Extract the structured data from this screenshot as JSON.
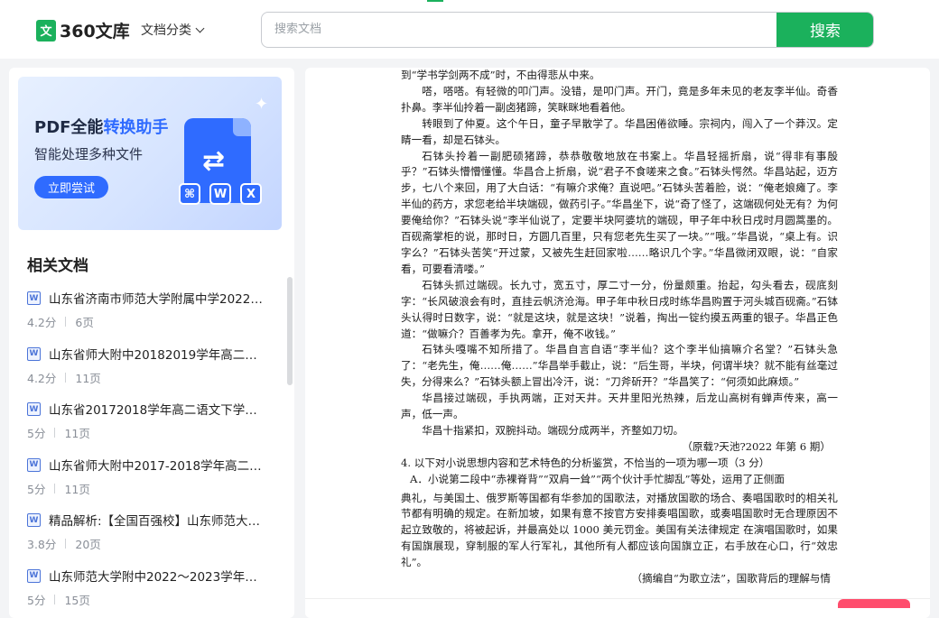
{
  "header": {
    "logo_mark": "文",
    "logo_text": "360文库",
    "category_label": "文档分类",
    "search_placeholder": "搜索文档",
    "search_button": "搜索"
  },
  "banner": {
    "title_a": "PDF全能",
    "title_b": "转换助手",
    "subtitle": "智能处理多种文件",
    "button": "立即尝试",
    "icons": [
      "pdf-icon",
      "word-icon",
      "excel-icon"
    ],
    "icon_w": "W",
    "icon_x": "X",
    "accent_color": "#2f6bff"
  },
  "related": {
    "title": "相关文档",
    "items": [
      {
        "title": "山东省济南市师范大学附属中学2022…",
        "score": "4.2分",
        "pages": "6页"
      },
      {
        "title": "山东省师大附中20182019学年高二…",
        "score": "4.2分",
        "pages": "11页"
      },
      {
        "title": "山东省20172018学年高二语文下学…",
        "score": "5分",
        "pages": "11页"
      },
      {
        "title": "山东省师大附中2017-2018学年高二…",
        "score": "5分",
        "pages": "11页"
      },
      {
        "title": "精品解析:【全国百强校】山东师范大…",
        "score": "3.8分",
        "pages": "20页"
      },
      {
        "title": "山东师范大学附中2022～2023学年…",
        "score": "5分",
        "pages": "15页"
      }
    ]
  },
  "document": {
    "paragraphs": [
      {
        "text": "到“学书学剑两不成”时，不由得悲从中来。",
        "style": "noind"
      },
      {
        "text": "嗒，嗒嗒。有轻微的叩门声。没错，是叩门声。开门，竟是多年未见的老友李半仙。奇香扑鼻。李半仙拎着一副卤猪蹄，笑眯眯地看着他。",
        "style": ""
      },
      {
        "text": "转眼到了仲夏。这个午日，童子早散学了。华昌困倦欲睡。宗祠内，闯入了一个莽汉。定睛一看，却是石钵头。",
        "style": ""
      },
      {
        "text": "石钵头拎着一副肥硕猪蹄，恭恭敬敬地放在书案上。华昌轻摇折扇，说“得非有事殷乎？”石钵头懵懵懂懂。华昌合上折扇，说“君子不食嗟来之食。”石钵头愕然。华昌站起，迈方步，七八个来回，用了大白话：“有嘛介求俺？直说吧。”石钵头苦着脸，说：“俺老娘瘫了。李半仙的药方，求您老给半块端砚，做药引子。”华昌坐下，说“奇了怪了，这端砚何处无有？为何要俺给你？”石钵头说“李半仙说了，定要半块阿婆坑的端砚，甲子年中秋日戌时月圆蒿墨的。百砚斋掌柜的说，那时日，方圆几百里，只有您老先生买了一块。”“哦。”华昌说，“桌上有。识字么？”石钵头苦笑“开过蒙，又被先生赶回家啦……略识几个字。”华昌微闭双眼，说：“自家看，可要看清喽。”",
        "style": ""
      },
      {
        "text": "石钵头抓过端砚。长九寸，宽五寸，厚二寸一分，份量颇重。抬起，勾头看去，砚底刻字：“长风破浪会有时，直挂云帆济沧海。甲子年中秋日戌时练华昌购置于河头城百砚斋。”石钵头认得时日数字，说：“就是这块，就是这块！”说着，掏出一锭约摸五两重的银子。华昌正色道：“做嘛介？百善孝为先。拿开，俺不收钱。”",
        "style": ""
      },
      {
        "text": "石钵头嘎嘴不知所措了。华昌自言自语“李半仙？这个李半仙搞嘛介名堂？”石钵头急了：“老先生，俺……俺……”华昌举手截止，说：“后生哥，半块，何谓半块？就不能有丝毫过失，分得来么？”石钵头额上冒出冷汗，说：“刀斧斫开？”华昌笑了：“何须如此麻烦。”",
        "style": ""
      },
      {
        "text": "华昌接过端砚，手执两端，正对天井。天井里阳光热辣，后龙山高树有蝉声传来，高一声，低一声。",
        "style": ""
      },
      {
        "text": "华昌十指紧扣，双腕抖动。端砚分成两半，齐整如刀切。",
        "style": ""
      },
      {
        "text": "（原载?天池?2022 年第 6 期）",
        "style": "right"
      },
      {
        "text": "4. 以下对小说思想内容和艺术特色的分析鉴赏，不恰当的一项为哪一项（3 分）",
        "style": "noind"
      },
      {
        "text": "A．小说第二段中“赤裸脊背”“双肩一耸”“两个伙计手忙脚乱”等处，运用了正侧面",
        "style": "opt"
      }
    ],
    "paragraphs_after_cut": [
      {
        "text": "典礼，与美国土、俄罗斯等国都有华参加的国歌法，对播放国歌的场合、奏唱国歌时的相关礼节都有明确的规定。在新加坡，如果有意不按官方安排奏唱国歌，或奏唱国歌时无合理原因不起立致敬的，将被起诉，并最高处以 1000 美元罚金。美国有关法律规定 在演唱国歌时，如果有国旗展现，穿制服的军人行军礼，其他所有人都应该向国旗立正，右手放在心口，行“效忠礼”。",
        "style": "noind"
      },
      {
        "text": "（摘编自“为歌立法”，国歌背后的理解与情",
        "style": "right"
      }
    ]
  },
  "colors": {
    "brand": "#1bb15c",
    "banner_blue": "#2f6bff",
    "page_bg": "#f3f4f6"
  }
}
